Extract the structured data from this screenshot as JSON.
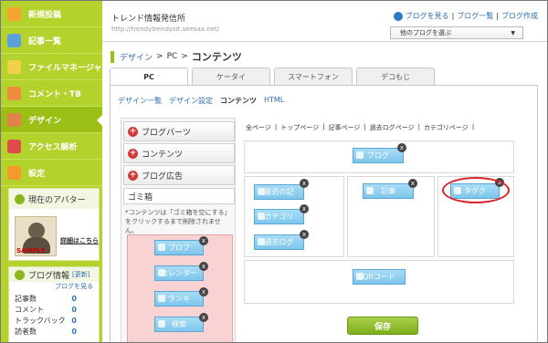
{
  "nav": [
    {
      "label": "新規投稿",
      "icon": "pencil-icon",
      "color": "#f7a531"
    },
    {
      "label": "記事一覧",
      "icon": "document-icon",
      "color": "#5aa0dc"
    },
    {
      "label": "ファイルマネージャ",
      "icon": "clipboard-icon",
      "color": "#f2d14a"
    },
    {
      "label": "コメント・TB",
      "icon": "speech-bubble-icon",
      "color": "#f08a3c"
    },
    {
      "label": "デザイン",
      "icon": "palette-icon",
      "color": "#e1824a"
    },
    {
      "label": "アクセス解析",
      "icon": "bar-chart-icon",
      "color": "#e14a4a"
    },
    {
      "label": "設定",
      "icon": "gear-icon",
      "color": "#f59a2a"
    }
  ],
  "avatar": {
    "title": "現在のアバター",
    "sample": "SAMPLE",
    "link": "詳細はこちら"
  },
  "blog_info": {
    "title": "ブログ情報",
    "detail": "[更新]",
    "view": "ブログを見る",
    "stats": [
      {
        "label": "記事数",
        "value": "0"
      },
      {
        "label": "コメント",
        "value": "0"
      },
      {
        "label": "トラックバック",
        "value": "0"
      },
      {
        "label": "読者数",
        "value": "0"
      }
    ]
  },
  "header": {
    "site_name": "トレンド情報発信所",
    "site_url": "http://trendytrendysit.seesaa.net/",
    "links": [
      "ブログを見る",
      "ブログ一覧",
      "ブログ作成"
    ],
    "other_blog": "他のブログを選ぶ"
  },
  "breadcrumb": {
    "design": "デザイン",
    "pc": "PC",
    "current": "コンテンツ"
  },
  "tabs": [
    "PC",
    "ケータイ",
    "スマートフォン",
    "デコもじ"
  ],
  "subnav": [
    "デザイン一覧",
    "デザイン設定",
    "コンテンツ",
    "HTML"
  ],
  "parts": {
    "blog_parts": "ブログパーツ",
    "contents": "コンテンツ",
    "blog_ads": "ブログ広告",
    "trash": "ゴミ箱",
    "trash_desc": "*コンテンツは「ゴミ箱を空にする」をクリックするまで削除されません。"
  },
  "trash_widgets": [
    "プロフ",
    "カレンダー",
    "ランキ",
    "検索"
  ],
  "page_links": [
    "全ページ",
    "トップページ",
    "記事ページ",
    "過去ログページ",
    "カテゴリページ"
  ],
  "layout_widgets": {
    "header": "ブログ",
    "left": [
      "最近の記",
      "カテゴリ",
      "過去ログ"
    ],
    "center": "記事",
    "right": "タグク",
    "footer": "QRコード"
  },
  "save": "保存"
}
